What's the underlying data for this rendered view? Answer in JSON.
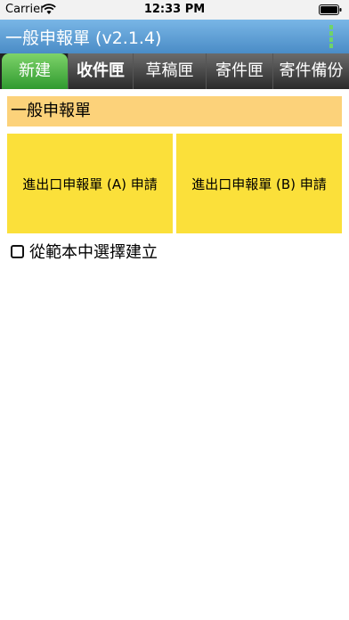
{
  "status_bar": {
    "carrier": "Carrier",
    "time": "12:33 PM"
  },
  "title_bar": {
    "title": "一般申報單 (v2.1.4)"
  },
  "tabs": [
    {
      "label": "新建",
      "active": true
    },
    {
      "label": "收件匣",
      "active": false
    },
    {
      "label": "草稿匣",
      "active": false
    },
    {
      "label": "寄件匣",
      "active": false
    },
    {
      "label": "寄件備份",
      "active": false
    }
  ],
  "section": {
    "title": "一般申報單"
  },
  "buttons": {
    "declaration_a": "進出口申報單 (A) 申請",
    "declaration_b": "進出口申報單 (B) 申請"
  },
  "template_option": {
    "label": "從範本中選擇建立",
    "checked": false
  },
  "colors": {
    "title_bar": "#5a9bd5",
    "active_tab": "#4caf50",
    "section_header": "#fcd27a",
    "button": "#fbe03a"
  }
}
